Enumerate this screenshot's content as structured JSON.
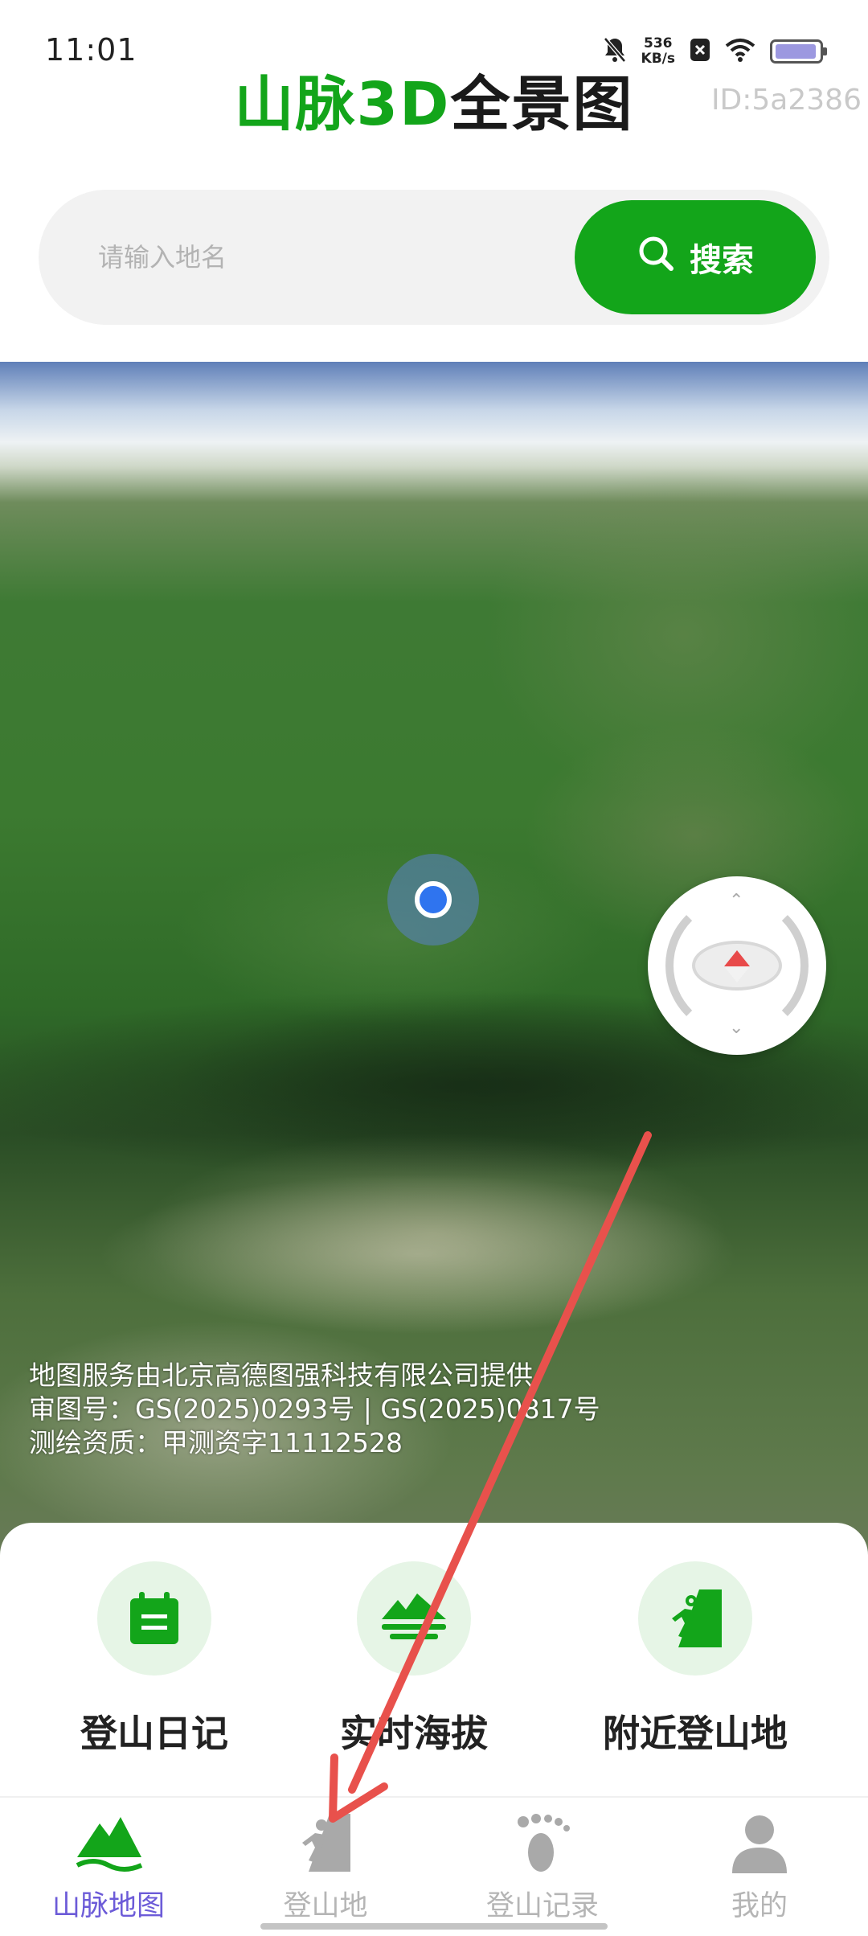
{
  "status_bar": {
    "time": "11:01",
    "net_speed_value": "536",
    "net_speed_unit": "KB/s",
    "icons": [
      "mute-bell-icon",
      "sim-off-icon",
      "wifi-icon",
      "battery-icon"
    ]
  },
  "header": {
    "title_green": "山脉3D",
    "title_dark": "全景图",
    "user_id": "ID:5a2386"
  },
  "search": {
    "placeholder": "请输入地名",
    "value": "",
    "button_label": "搜索"
  },
  "map": {
    "credits": [
      "地图服务由北京高德图强科技有限公司提供",
      "审图号：GS(2025)0293号 | GS(2025)0817号",
      "测绘资质：甲测资字11112528"
    ]
  },
  "features": [
    {
      "label": "登山日记",
      "icon": "calendar-icon"
    },
    {
      "label": "实时海拔",
      "icon": "altitude-mountain-icon"
    },
    {
      "label": "附近登山地",
      "icon": "climber-icon"
    }
  ],
  "tabs": [
    {
      "label": "山脉地图",
      "icon": "mountain-icon",
      "active": true
    },
    {
      "label": "登山地",
      "icon": "climber-icon",
      "active": false
    },
    {
      "label": "登山记录",
      "icon": "footprint-icon",
      "active": false
    },
    {
      "label": "我的",
      "icon": "person-icon",
      "active": false
    }
  ],
  "colors": {
    "brand_green": "#13a51a",
    "active_tab": "#6c5bd8",
    "inactive_tab": "#b5b5b5",
    "annotation_arrow": "#e8514c"
  }
}
